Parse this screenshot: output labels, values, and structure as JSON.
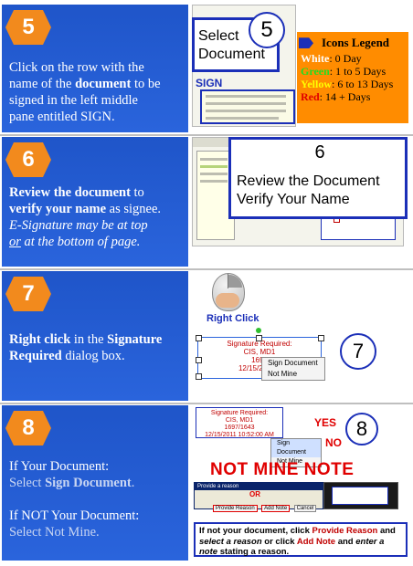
{
  "steps": [
    {
      "number": "5",
      "lines": [
        {
          "parts": [
            {
              "t": "Click on the row with the"
            }
          ]
        },
        {
          "parts": [
            {
              "t": "name of the "
            },
            {
              "t": "document",
              "b": true
            },
            {
              "t": " to be"
            }
          ]
        },
        {
          "parts": [
            {
              "t": "signed in the left middle"
            }
          ]
        },
        {
          "parts": [
            {
              "t": "pane entitled SIGN."
            }
          ]
        }
      ]
    },
    {
      "number": "6",
      "lines": [
        {
          "parts": [
            {
              "t": "Review the document",
              "b": true
            },
            {
              "t": " to"
            }
          ]
        },
        {
          "parts": [
            {
              "t": "verify your name",
              "b": true
            },
            {
              "t": " as signee."
            }
          ]
        },
        {
          "parts": [
            {
              "t": "E-Signature may be at top",
              "i": true
            }
          ]
        },
        {
          "parts": [
            {
              "t": "or",
              "i": true,
              "u": true
            },
            {
              "t": " at the bottom of page.",
              "i": true
            }
          ]
        }
      ]
    },
    {
      "number": "7",
      "lines": [
        {
          "parts": [
            {
              "t": "Right click",
              "b": true
            },
            {
              "t": " in the "
            },
            {
              "t": "Signature",
              "b": true
            }
          ]
        },
        {
          "parts": [
            {
              "t": "Required",
              "b": true
            },
            {
              "t": " dialog box."
            }
          ]
        }
      ]
    },
    {
      "number": "8",
      "lines": [
        {
          "parts": [
            {
              "t": "If Your Document:"
            }
          ]
        },
        {
          "parts": [
            {
              "t": "Select ",
              "dim": true
            },
            {
              "t": "Sign Document",
              "b": true,
              "dim": true
            },
            {
              "t": ".",
              "dim": true
            }
          ]
        },
        {
          "parts": [
            {
              "t": " "
            }
          ]
        },
        {
          "parts": [
            {
              "t": "If NOT Your Document:"
            }
          ]
        },
        {
          "parts": [
            {
              "t": "Select Not Mine.",
              "dim": true
            }
          ]
        }
      ]
    }
  ],
  "step5": {
    "callout_line1": "Select",
    "callout_line2": "Document",
    "circle": "5",
    "sign_label": "SIGN",
    "legend_title": "Icons Legend",
    "legend": [
      {
        "label": "White",
        "text": ": 0 Day",
        "color": "#ffffff"
      },
      {
        "label": "Green",
        "text": ": 1 to 5 Days",
        "color": "#22dd22"
      },
      {
        "label": "Yellow",
        "text": ": 6 to 13 Days",
        "color": "#ffff00"
      },
      {
        "label": "Red",
        "text": ": 14 + Days",
        "color": "#e00000"
      }
    ]
  },
  "step6": {
    "circle": "6",
    "line1": "Review the Document",
    "line2": "Verify Your Name"
  },
  "step7": {
    "right_click_label": "Right Click",
    "sig_title": "Signature Required:",
    "sig_name": "CIS, MD1",
    "sig_id": "1697",
    "sig_date": "12/15/2011 1",
    "menu": [
      "Sign Document",
      "Not Mine"
    ],
    "circle": "7"
  },
  "step8": {
    "sig_title": "Signature Required:",
    "sig_name": "CIS, MD1",
    "sig_id": "1697/1643",
    "sig_date": "12/15/2011 10:52:00 AM",
    "menu": [
      "Sign Document",
      "Not Mine"
    ],
    "yes": "YES",
    "no": "NO",
    "circle": "8",
    "not_mine_note": "NOT MINE NOTE",
    "dialog_title": "Provide a reason",
    "or_label": "OR",
    "buttons": [
      "Provide Reason",
      "Add Note",
      "Cancel"
    ],
    "instruction_parts": [
      {
        "t": "If not your document, click ",
        "b": true
      },
      {
        "t": "Provide Reason",
        "b": true,
        "c": "#c00000"
      },
      {
        "t": " and ",
        "b": true
      },
      {
        "t": "select a reason",
        "b": true,
        "i": true
      },
      {
        "t": " or click ",
        "b": true
      },
      {
        "t": "Add Note",
        "b": true,
        "c": "#c00000"
      },
      {
        "t": " and ",
        "b": true
      },
      {
        "t": "enter a note",
        "b": true,
        "i": true
      },
      {
        "t": " stating a reason.",
        "b": true
      }
    ]
  }
}
